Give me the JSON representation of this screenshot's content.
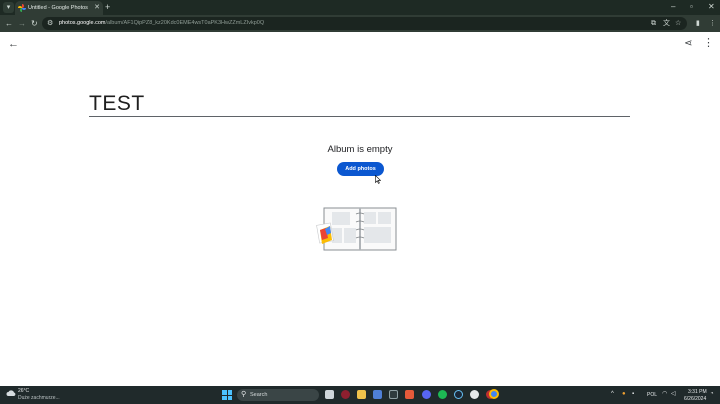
{
  "browser": {
    "tab_title": "Untitled - Google Photos",
    "url_host": "photos.google.com",
    "url_path": "/album/AF1QipPZ8_kz20Kdc0EME4wsT0aPK3HwZZmLZIvkp0Q"
  },
  "page": {
    "album_title": "TEST",
    "empty_message": "Album is empty",
    "add_photos_label": "Add photos"
  },
  "taskbar": {
    "weather_temp": "26°C",
    "weather_desc": "Duże zachmurze...",
    "search_label": "Search",
    "language": "POL",
    "time": "3:31 PM",
    "date": "6/26/2024"
  },
  "colors": {
    "accent": "#0b57d0",
    "chrome_dark": "#1e2a24",
    "toolbar": "#303c35",
    "taskbar": "#202a2b"
  },
  "icons": {
    "back": "arrow-left-icon",
    "share": "share-icon",
    "more": "more-vert-icon"
  }
}
